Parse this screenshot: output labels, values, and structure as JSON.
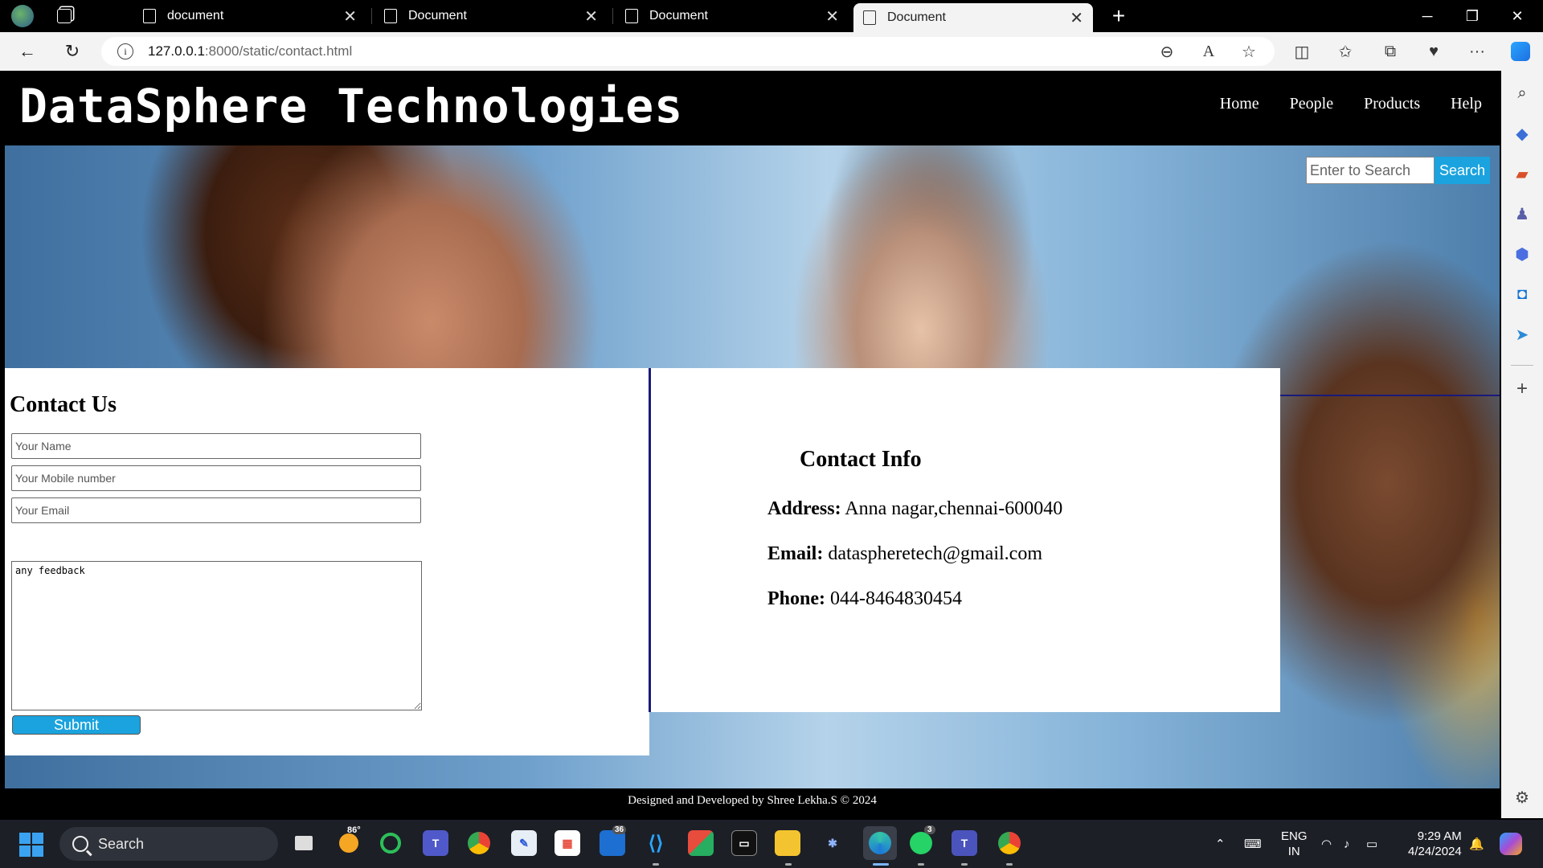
{
  "browser": {
    "tabs": [
      {
        "title": "document"
      },
      {
        "title": "Document"
      },
      {
        "title": "Document"
      },
      {
        "title": "Document"
      }
    ],
    "tab_close_glyph": "✕",
    "new_tab_glyph": "+",
    "url_host": "127.0.0.1",
    "url_path": ":8000/static/contact.html"
  },
  "site": {
    "title": "DataSphere Technologies",
    "nav": [
      "Home",
      "People",
      "Products",
      "Help"
    ],
    "search": {
      "placeholder": "Enter to Search",
      "button": "Search"
    },
    "contact": {
      "heading": "Contact Us",
      "name_placeholder": "Your Name",
      "mobile_placeholder": "Your Mobile number",
      "email_placeholder": "Your Email",
      "feedback_value": "any feedback",
      "submit": "Submit"
    },
    "info": {
      "heading": "Contact Info",
      "address_label": "Address:",
      "address_value": "Anna nagar,chennai-600040",
      "email_label": "Email:",
      "email_value": "dataspheretech@gmail.com",
      "phone_label": "Phone:",
      "phone_value": "044-8464830454"
    },
    "footer": "Designed and Developed by Shree Lekha.S © 2024"
  },
  "taskbar": {
    "search_label": "Search",
    "weather_temp": "86°",
    "badge_36": "36",
    "badge_3": "3",
    "lang_line1": "ENG",
    "lang_line2": "IN",
    "time": "9:29 AM",
    "date": "4/24/2024"
  },
  "colors": {
    "accent_button": "#1aa3de",
    "header_bg": "#000000",
    "divider": "#1a1a7a"
  },
  "icons": {
    "back": "back-arrow-icon",
    "refresh": "refresh-icon",
    "info": "site-info-icon",
    "zoom": "zoom-out-icon",
    "read_aloud": "read-aloud-icon",
    "favorite": "star-icon",
    "split": "split-screen-icon",
    "favorites": "favorites-icon",
    "collections": "collections-icon",
    "more": "more-icon",
    "copilot": "copilot-icon"
  }
}
